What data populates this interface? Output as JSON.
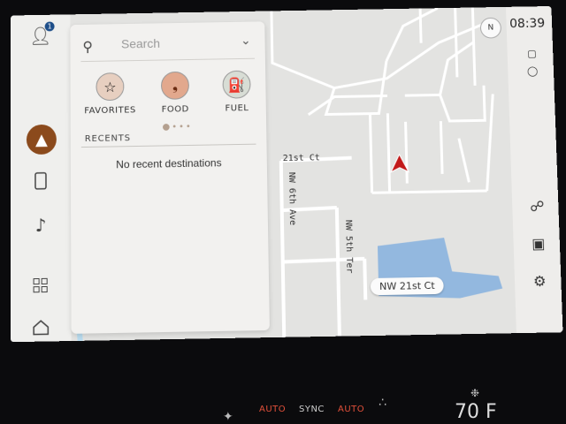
{
  "rail": {
    "profile_badge": "1",
    "icons": [
      "profile-icon",
      "navigation-icon",
      "phone-icon",
      "music-icon",
      "apps-grid-icon",
      "home-icon"
    ]
  },
  "search": {
    "placeholder": "Search"
  },
  "categories": [
    {
      "label": "FAVORITES",
      "icon": "star-icon"
    },
    {
      "label": "FOOD",
      "icon": "fork-knife-icon"
    },
    {
      "label": "FUEL",
      "icon": "fuel-pump-icon"
    }
  ],
  "recents": {
    "header": "RECENTS",
    "empty_text": "No recent destinations"
  },
  "map": {
    "road_labels": [
      "21st Ct",
      "NW 6th Ave",
      "NW 5th Ter"
    ],
    "current_street": "NW 21st Ct"
  },
  "status": {
    "time": "08:39",
    "compass": "N"
  },
  "climate": {
    "left_auto": "AUTO",
    "sync": "SYNC",
    "right_auto": "AUTO",
    "temp": "70 F"
  },
  "colors": {
    "accent_nav": "#8b4a1c",
    "vehicle_marker": "#c21a1a",
    "water": "#93b8df",
    "climate_auto": "#e2503a"
  }
}
